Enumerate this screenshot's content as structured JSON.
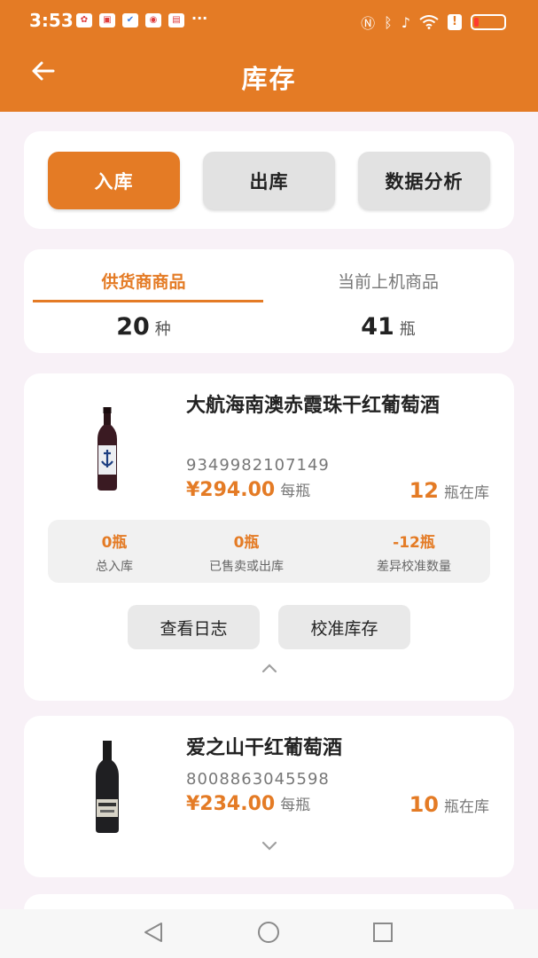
{
  "status_bar": {
    "time": "3:53",
    "notifications": [
      "huawei-app",
      "red-app",
      "shield-app",
      "weibo-app",
      "book-app"
    ],
    "more": "···"
  },
  "header": {
    "title": "库存",
    "back_icon": "arrow-left-icon"
  },
  "actions": {
    "stock_in": "入库",
    "stock_out": "出库",
    "analytics": "数据分析"
  },
  "tabs": [
    {
      "label": "供货商商品",
      "value": "20",
      "unit": "种",
      "active": true
    },
    {
      "label": "当前上机商品",
      "value": "41",
      "unit": "瓶",
      "active": false
    }
  ],
  "products": [
    {
      "name": "大航海南澳赤霞珠干红葡萄酒",
      "code": "9349982107149",
      "price": "¥294.00",
      "price_unit": "每瓶",
      "stock": "12",
      "stock_unit": "瓶在库",
      "expanded": true,
      "stats": [
        {
          "value": "0瓶",
          "label": "总入库"
        },
        {
          "value": "0瓶",
          "label": "已售卖或出库"
        },
        {
          "value": "-12瓶",
          "label": "差异校准数量"
        }
      ],
      "buttons": {
        "log": "查看日志",
        "calibrate": "校准库存"
      }
    },
    {
      "name": "爱之山干红葡萄酒",
      "code": "8008863045598",
      "price": "¥234.00",
      "price_unit": "每瓶",
      "stock": "10",
      "stock_unit": "瓶在库",
      "expanded": false
    }
  ],
  "colors": {
    "accent": "#e47b25",
    "background": "#f8f1f7"
  }
}
